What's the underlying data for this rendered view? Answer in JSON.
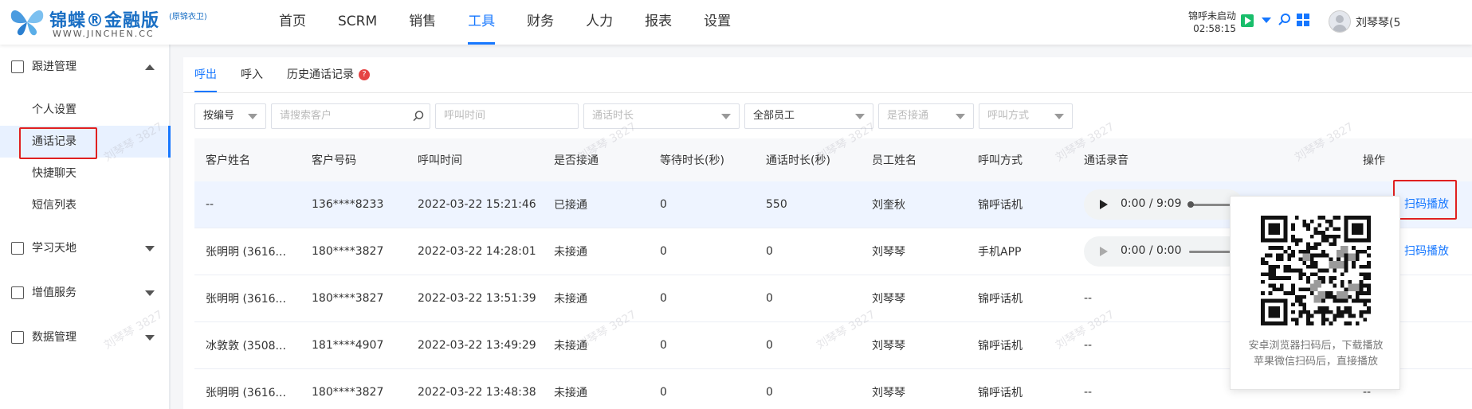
{
  "header": {
    "logo_main": "锦蝶®金融版",
    "logo_sub": "(原锦衣卫)",
    "logo_url": "WWW.JINCHEN.CC",
    "nav": [
      "首页",
      "SCRM",
      "销售",
      "工具",
      "财务",
      "人力",
      "报表",
      "设置"
    ],
    "active_nav": "工具",
    "call_status": "锦呼未启动",
    "call_time": "02:58:15",
    "user_name": "刘琴琴(5"
  },
  "sidebar": {
    "groups": [
      {
        "label": "跟进管理",
        "expanded": true,
        "items": [
          "个人设置",
          "通话记录",
          "快捷聊天",
          "短信列表"
        ]
      },
      {
        "label": "学习天地",
        "expanded": false
      },
      {
        "label": "增值服务",
        "expanded": false
      },
      {
        "label": "数据管理",
        "expanded": false
      }
    ],
    "active_item": "通话记录"
  },
  "tabs": [
    {
      "label": "呼出",
      "active": true
    },
    {
      "label": "呼入",
      "active": false
    },
    {
      "label": "历史通话记录",
      "active": false,
      "badge": "?"
    }
  ],
  "filters": {
    "search_type": "按编号",
    "search_placeholder": "请搜索客户",
    "call_time_placeholder": "呼叫时间",
    "duration_placeholder": "通话时长",
    "employee": "全部员工",
    "connected_placeholder": "是否接通",
    "call_mode_placeholder": "呼叫方式"
  },
  "table": {
    "headers": [
      "客户姓名",
      "客户号码",
      "呼叫时间",
      "是否接通",
      "等待时长(秒)",
      "通话时长(秒)",
      "员工姓名",
      "呼叫方式",
      "通话录音",
      "操作"
    ],
    "rows": [
      {
        "name": "--",
        "phone": "136****8233",
        "time": "2022-03-22 15:21:46",
        "connected": "已接通",
        "wait": "0",
        "duration": "550",
        "employee": "刘奎秋",
        "mode": "锦呼话机",
        "recording": "0:00 / 9:09",
        "action": "扫码播放"
      },
      {
        "name": "张明明 (3616...",
        "phone": "180****3827",
        "time": "2022-03-22 14:28:01",
        "connected": "未接通",
        "wait": "0",
        "duration": "0",
        "employee": "刘琴琴",
        "mode": "手机APP",
        "recording": "0:00 / 0:00",
        "action": "扫码播放"
      },
      {
        "name": "张明明 (3616...",
        "phone": "180****3827",
        "time": "2022-03-22 13:51:39",
        "connected": "未接通",
        "wait": "0",
        "duration": "0",
        "employee": "刘琴琴",
        "mode": "锦呼话机",
        "recording": "--",
        "action": ""
      },
      {
        "name": "冰敦敦 (3508...",
        "phone": "181****4907",
        "time": "2022-03-22 13:49:29",
        "connected": "未接通",
        "wait": "0",
        "duration": "0",
        "employee": "刘琴琴",
        "mode": "锦呼话机",
        "recording": "--",
        "action": ""
      },
      {
        "name": "张明明 (3616...",
        "phone": "180****3827",
        "time": "2022-03-22 13:48:38",
        "connected": "未接通",
        "wait": "0",
        "duration": "0",
        "employee": "刘琴琴",
        "mode": "锦呼话机",
        "recording": "--",
        "action": "--"
      }
    ]
  },
  "popup": {
    "line1": "安卓浏览器扫码后，下载播放",
    "line2": "苹果微信扫码后，直接播放"
  },
  "watermark": "刘琴琴 3827",
  "colors": {
    "accent": "#1677ff",
    "highlight_box": "#e02020",
    "row_highlight": "#eef4ff"
  }
}
